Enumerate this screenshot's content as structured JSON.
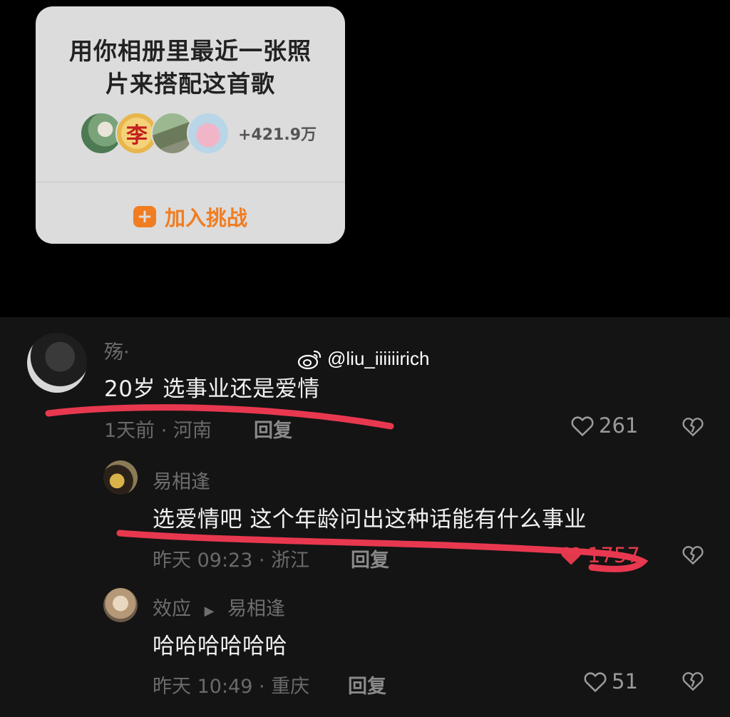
{
  "challenge_card": {
    "title_line1": "用你相册里最近一张照",
    "title_line2": "片来搭配这首歌",
    "avatar2_char": "李",
    "participants": "+421.9万",
    "join_label": "加入挑战"
  },
  "watermark": {
    "text": "@liu_iiiiiirich"
  },
  "comments": [
    {
      "author": "殇·",
      "text": "20岁 选事业还是爱情",
      "meta": "1天前 · 河南",
      "reply_label": "回复",
      "likes": "261"
    },
    {
      "author": "易相逢",
      "text": "选爱情吧 这个年龄问出这种话能有什么事业",
      "meta": "昨天 09:23 · 浙江",
      "reply_label": "回复",
      "likes": "1757",
      "liked": true
    },
    {
      "author": "效应",
      "reply_to": "易相逢",
      "text": "哈哈哈哈哈哈",
      "meta": "昨天 10:49 · 重庆",
      "reply_label": "回复",
      "likes": "51"
    }
  ],
  "colors": {
    "accent": "#f07d22",
    "highlight_stroke": "#e8384f",
    "liked": "#e03a4a"
  }
}
